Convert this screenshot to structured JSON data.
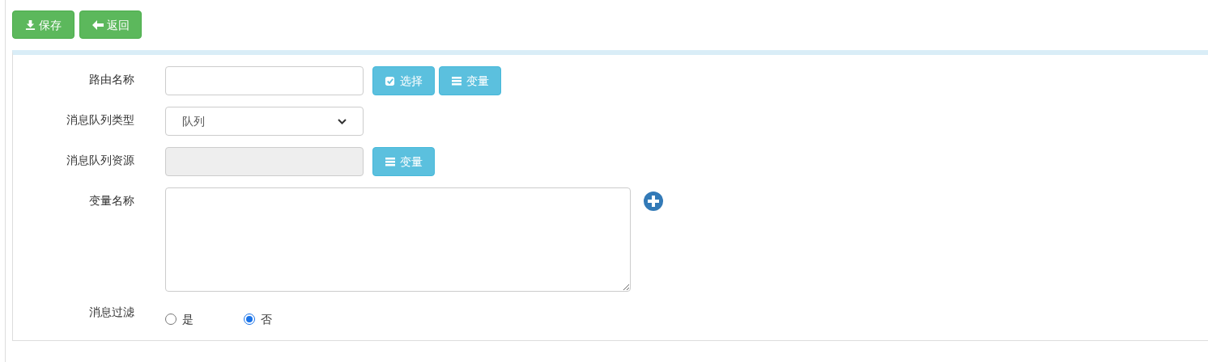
{
  "toolbar": [
    {
      "label": "保存",
      "kind": "download"
    },
    {
      "label": "返回",
      "kind": "back"
    }
  ],
  "form": [
    {
      "kind": "text",
      "label": "路由名称",
      "buttons": [
        {
          "label": "选择",
          "kind": "check"
        },
        {
          "label": "变量",
          "kind": "list"
        }
      ]
    },
    {
      "kind": "select",
      "label": "消息队列类型",
      "value": "队列"
    },
    {
      "kind": "readonly",
      "label": "消息队列资源",
      "disabled": true,
      "buttons": [
        {
          "label": "变量",
          "kind": "list"
        }
      ]
    },
    {
      "kind": "textarea",
      "label": "变量名称",
      "add": true
    },
    {
      "kind": "radio",
      "label": "消息过滤",
      "options": [
        {
          "label": "是",
          "selected": false
        },
        {
          "label": "否",
          "selected": true
        }
      ]
    }
  ]
}
